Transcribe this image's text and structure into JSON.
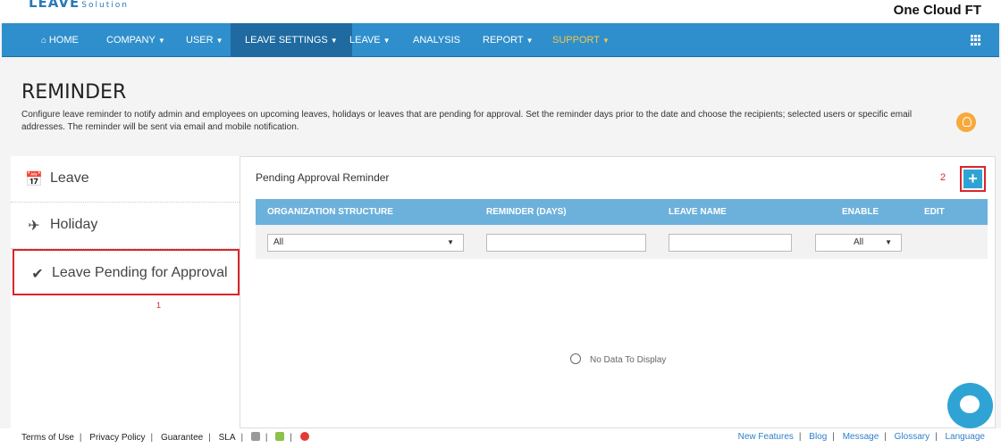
{
  "brand": {
    "logo_main": "LEAVE",
    "logo_sub": "Solution",
    "company": "One Cloud FT"
  },
  "nav": [
    {
      "label": "HOME",
      "caret": false,
      "icon": "home-icon"
    },
    {
      "label": "COMPANY",
      "caret": true
    },
    {
      "label": "USER",
      "caret": true
    },
    {
      "label": "LEAVE SETTINGS",
      "caret": true,
      "active": true
    },
    {
      "label": "LEAVE",
      "caret": true
    },
    {
      "label": "ANALYSIS",
      "caret": false
    },
    {
      "label": "REPORT",
      "caret": true
    },
    {
      "label": "SUPPORT",
      "caret": true
    }
  ],
  "page": {
    "title": "REMINDER",
    "description": "Configure leave reminder to notify admin and employees on upcoming leaves, holidays or leaves that are pending for approval. Set the reminder days prior to the date and choose the recipients; selected users or specific email addresses. The reminder will be sent via email and mobile notification."
  },
  "sidebar": {
    "items": [
      {
        "label": "Leave",
        "icon": "calendar-icon"
      },
      {
        "label": "Holiday",
        "icon": "plane-icon"
      },
      {
        "label": "Leave Pending for Approval",
        "icon": "check-icon",
        "selected": true
      }
    ],
    "marker": "1"
  },
  "panel": {
    "title": "Pending Approval Reminder",
    "marker": "2",
    "add_label": "+",
    "columns": [
      "ORGANIZATION STRUCTURE",
      "REMINDER (DAYS)",
      "LEAVE NAME",
      "ENABLE",
      "EDIT"
    ],
    "filters": {
      "org": "All",
      "enable": "All"
    },
    "empty": "No Data To Display"
  },
  "footer": {
    "left": [
      "Terms of Use",
      "Privacy Policy",
      "Guarantee",
      "SLA"
    ],
    "right": [
      "New Features",
      "Blog",
      "Message",
      "Glossary",
      "Language"
    ]
  },
  "colors": {
    "nav": "#2f8fcc",
    "active": "#1f6aa0",
    "highlight": "#d9262a",
    "header": "#6cb1dc"
  }
}
